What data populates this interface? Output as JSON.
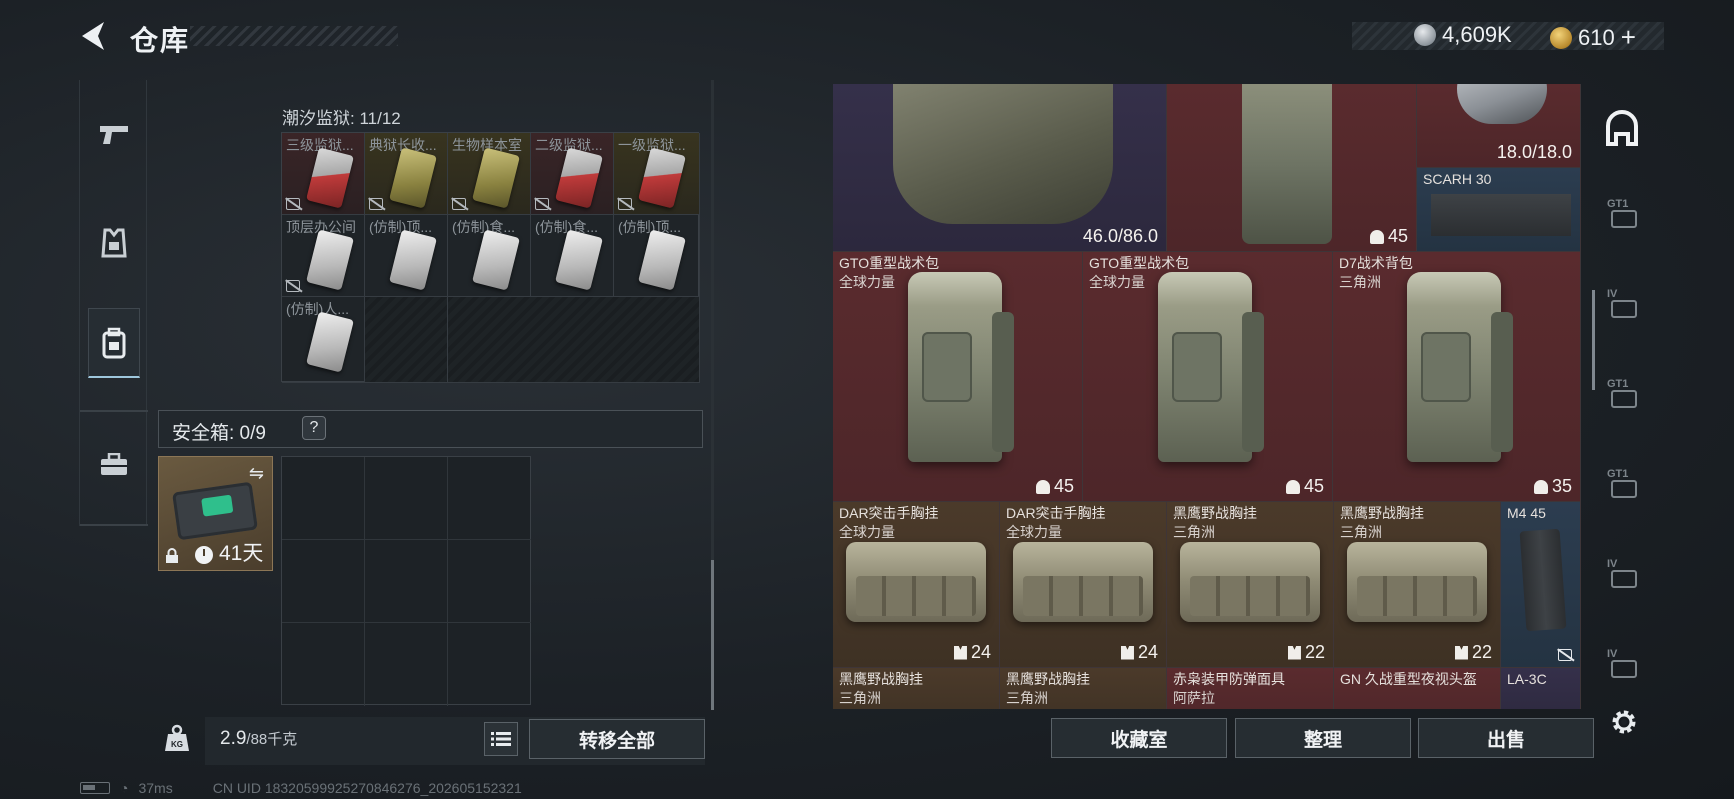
{
  "header": {
    "title": "仓库",
    "currency": [
      {
        "icon": "silver-coin-icon",
        "value": "4,609K"
      },
      {
        "icon": "gold-coin-icon",
        "value": "610",
        "add_label": "+"
      }
    ]
  },
  "left_rail": {
    "tabs": [
      {
        "name": "weapons",
        "icon": "pistol-icon",
        "active": false
      },
      {
        "name": "armor",
        "icon": "armor-icon",
        "active": false
      },
      {
        "name": "backpack",
        "icon": "backpack-icon",
        "active": true
      },
      {
        "name": "toolbox",
        "icon": "toolbox-icon",
        "active": false
      }
    ]
  },
  "prison": {
    "label": "潮汐监狱: 11/12",
    "cells": [
      {
        "label": "三级监狱...",
        "card": "red",
        "tint": "red",
        "no_carry": true
      },
      {
        "label": "典狱长收...",
        "card": "yellow",
        "tint": "yellow",
        "no_carry": true
      },
      {
        "label": "生物样本室",
        "card": "yellow",
        "tint": "yellow",
        "no_carry": true
      },
      {
        "label": "二级监狱...",
        "card": "red",
        "tint": "red",
        "no_carry": true
      },
      {
        "label": "一级监狱...",
        "card": "red",
        "tint": "yellow",
        "no_carry": true
      },
      {
        "label": "顶层办公间",
        "card": "white",
        "tint": "none",
        "no_carry": true
      },
      {
        "label": "(仿制)顶...",
        "card": "white",
        "tint": "none",
        "no_carry": false
      },
      {
        "label": "(仿制)食...",
        "card": "white",
        "tint": "none",
        "no_carry": false
      },
      {
        "label": "(仿制)食...",
        "card": "white",
        "tint": "none",
        "no_carry": false
      },
      {
        "label": "(仿制)顶...",
        "card": "white",
        "tint": "none",
        "no_carry": false
      },
      {
        "label": "(仿制)人...",
        "card": "white",
        "tint": "none",
        "no_carry": false
      }
    ]
  },
  "safe_box": {
    "label": "安全箱: 0/9",
    "help": "?",
    "days": "41天"
  },
  "weight": {
    "current": "2.9",
    "max": "/88千克"
  },
  "buttons": {
    "transfer_all": "转移全部",
    "collection": "收藏室",
    "sort": "整理",
    "sell": "出售"
  },
  "stash": {
    "top_row": {
      "armor_durability": "46.0/86.0",
      "pack_capacity": "45",
      "helmet_durability": "18.0/18.0",
      "mag_name": "SCARH 30"
    },
    "backpacks": [
      {
        "name": "GTO重型战术包",
        "brand": "全球力量",
        "capacity": "45"
      },
      {
        "name": "GTO重型战术包",
        "brand": "全球力量",
        "capacity": "45"
      },
      {
        "name": "D7战术背包",
        "brand": "三角洲",
        "capacity": "35"
      }
    ],
    "rigs": [
      {
        "name": "DAR突击手胸挂",
        "brand": "全球力量",
        "capacity": "24"
      },
      {
        "name": "DAR突击手胸挂",
        "brand": "全球力量",
        "capacity": "24"
      },
      {
        "name": "黑鹰野战胸挂",
        "brand": "三角洲",
        "capacity": "22"
      },
      {
        "name": "黑鹰野战胸挂",
        "brand": "三角洲",
        "capacity": "22"
      }
    ],
    "mag_m4": "M4 45",
    "bottom_row": [
      {
        "name": "黑鹰野战胸挂",
        "brand": "三角洲"
      },
      {
        "name": "黑鹰野战胸挂",
        "brand": "三角洲"
      },
      {
        "name": "赤枭装甲防弹面具",
        "brand": "阿萨拉"
      },
      {
        "name": "GN 久战重型夜视头盔",
        "brand": ""
      },
      {
        "name": "LA-3C",
        "brand": ""
      }
    ]
  },
  "right_rail": {
    "items": [
      "GT1",
      "IV",
      "GT1",
      "GT1",
      "IV",
      "IV"
    ]
  },
  "status": {
    "ping": "37ms",
    "uid": "CN UID 18320599925270846276_202605152321"
  },
  "colors": {
    "red_cell": "#5a2b2e",
    "brown_cell": "#4b3a2a",
    "purple_cell": "#35304a",
    "blue_cell": "#2c3d50",
    "active_tab": "#9ec7dd"
  }
}
